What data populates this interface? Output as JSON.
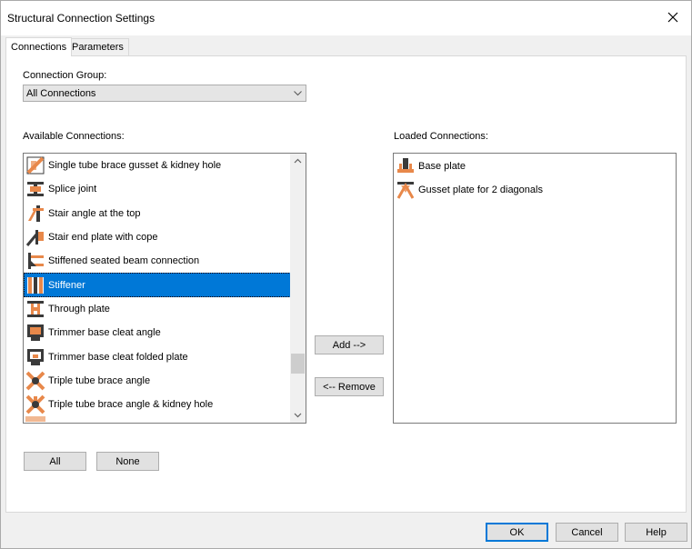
{
  "window": {
    "title": "Structural Connection Settings"
  },
  "tabs": [
    {
      "label": "Connections",
      "active": true
    },
    {
      "label": "Parameters",
      "active": false
    }
  ],
  "connection_group": {
    "label": "Connection Group:",
    "value": "All Connections"
  },
  "available": {
    "label": "Available Connections:",
    "items": [
      {
        "label": "Single tube brace gusset & kidney hole",
        "icon": "tube-brace-gusset-icon",
        "selected": false
      },
      {
        "label": "Splice joint",
        "icon": "splice-joint-icon",
        "selected": false
      },
      {
        "label": "Stair angle at the top",
        "icon": "stair-angle-icon",
        "selected": false
      },
      {
        "label": "Stair end plate with cope",
        "icon": "stair-end-plate-icon",
        "selected": false
      },
      {
        "label": "Stiffened seated beam connection",
        "icon": "seated-beam-icon",
        "selected": false
      },
      {
        "label": "Stiffener",
        "icon": "stiffener-icon",
        "selected": true
      },
      {
        "label": "Through plate",
        "icon": "through-plate-icon",
        "selected": false
      },
      {
        "label": "Trimmer base cleat angle",
        "icon": "trimmer-cleat-angle-icon",
        "selected": false
      },
      {
        "label": "Trimmer base cleat folded plate",
        "icon": "trimmer-folded-plate-icon",
        "selected": false
      },
      {
        "label": "Triple tube brace angle",
        "icon": "triple-tube-brace-icon",
        "selected": false
      },
      {
        "label": "Triple tube brace angle & kidney hole",
        "icon": "triple-tube-kidney-icon",
        "selected": false
      }
    ]
  },
  "loaded": {
    "label": "Loaded Connections:",
    "items": [
      {
        "label": "Base plate",
        "icon": "base-plate-icon"
      },
      {
        "label": "Gusset plate for 2 diagonals",
        "icon": "gusset-plate-icon"
      }
    ]
  },
  "buttons": {
    "add": "Add -->",
    "remove": "<-- Remove",
    "all": "All",
    "none": "None",
    "ok": "OK",
    "cancel": "Cancel",
    "help": "Help"
  },
  "colors": {
    "selection": "#0078d7",
    "icon_orange": "#e8884a",
    "icon_dark": "#3a3a3a"
  }
}
